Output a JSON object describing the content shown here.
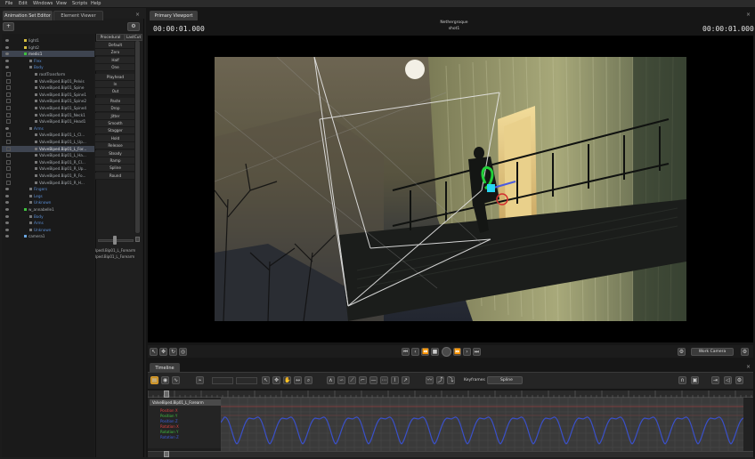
{
  "menu": [
    "File",
    "Edit",
    "Windows",
    "View",
    "Scripts",
    "Help"
  ],
  "left_tabs": {
    "animation_set_editor": "Animation Set Editor",
    "element_viewer": "Element Viewer"
  },
  "tree": [
    {
      "label": "light1",
      "type": "light",
      "state": "normal"
    },
    {
      "label": "light2",
      "type": "light",
      "state": "normal"
    },
    {
      "label": "medic1",
      "type": "model",
      "state": "selected"
    },
    {
      "label": "Flex",
      "type": "group",
      "state": "blue"
    },
    {
      "label": "Body",
      "type": "group",
      "state": "blue"
    },
    {
      "label": "rootTransform",
      "type": "item",
      "state": "normal"
    },
    {
      "label": "ValveBiped.Bip01_Pelvis",
      "type": "item",
      "state": "normal"
    },
    {
      "label": "ValveBiped.Bip01_Spine",
      "type": "item",
      "state": "normal"
    },
    {
      "label": "ValveBiped.Bip01_Spine1",
      "type": "item",
      "state": "normal"
    },
    {
      "label": "ValveBiped.Bip01_Spine2",
      "type": "item",
      "state": "normal"
    },
    {
      "label": "ValveBiped.Bip01_Spine4",
      "type": "item",
      "state": "normal"
    },
    {
      "label": "ValveBiped.Bip01_Neck1",
      "type": "item",
      "state": "normal"
    },
    {
      "label": "ValveBiped.Bip01_Head1",
      "type": "item",
      "state": "normal"
    },
    {
      "label": "Arms",
      "type": "group",
      "state": "blue"
    },
    {
      "label": "ValveBiped.Bip01_L_Cl...",
      "type": "item",
      "state": "normal"
    },
    {
      "label": "ValveBiped.Bip01_L_Up...",
      "type": "item",
      "state": "normal"
    },
    {
      "label": "ValveBiped.Bip01_L_For...",
      "type": "item",
      "state": "highlight"
    },
    {
      "label": "ValveBiped.Bip01_L_Ha...",
      "type": "item",
      "state": "normal"
    },
    {
      "label": "ValveBiped.Bip01_R_Cl...",
      "type": "item",
      "state": "normal"
    },
    {
      "label": "ValveBiped.Bip01_R_Up...",
      "type": "item",
      "state": "normal"
    },
    {
      "label": "ValveBiped.Bip01_R_Fo...",
      "type": "item",
      "state": "normal"
    },
    {
      "label": "ValveBiped.Bip01_R_H...",
      "type": "item",
      "state": "normal"
    },
    {
      "label": "Fingers",
      "type": "group",
      "state": "blue"
    },
    {
      "label": "Legs",
      "type": "group",
      "state": "blue"
    },
    {
      "label": "Unknown",
      "type": "group",
      "state": "blue"
    },
    {
      "label": "w_annabelle1",
      "type": "model",
      "state": "normal"
    },
    {
      "label": "Body",
      "type": "group",
      "state": "blue"
    },
    {
      "label": "Arms",
      "type": "group",
      "state": "blue"
    },
    {
      "label": "Unknown",
      "type": "group",
      "state": "blue"
    },
    {
      "label": "camera1",
      "type": "camera",
      "state": "normal"
    }
  ],
  "procedural": {
    "headers": [
      "Procedural",
      "LastCut"
    ],
    "items": [
      "Default",
      "Zero",
      "Half",
      "One",
      "Playhead",
      "In",
      "Out",
      "Paste",
      "Drop",
      "Jitter",
      "Smooth",
      "Stagger",
      "Hold",
      "Release",
      "Steady",
      "Ramp",
      "Spline",
      "Round"
    ]
  },
  "control_items": [
    "lpedl.Bip01_L_Forearm",
    "lped.Bip01_L_Forearm"
  ],
  "viewport": {
    "tab": "Primary Viewport",
    "timecode_left": "00:00:01.000",
    "timecode_right": "00:00:01.000",
    "camera_name": "Nethergroque",
    "shot_name": "shot1"
  },
  "viewbar": {
    "work_camera": "Work Camera"
  },
  "timeline": {
    "tab": "Timeline",
    "keyframes_label": "Keyframes",
    "interp_value": "Spline",
    "graph_title": "ValveBiped.Bip01_L_Forearm",
    "curves": [
      {
        "name": "Position X",
        "color": "#e04040"
      },
      {
        "name": "Position Y",
        "color": "#40c040"
      },
      {
        "name": "Position Z",
        "color": "#4060e0"
      },
      {
        "name": "Rotation X",
        "color": "#e04040"
      },
      {
        "name": "Rotation Y",
        "color": "#40c040"
      },
      {
        "name": "Rotation Z",
        "color": "#4060e0"
      }
    ]
  },
  "colors": {
    "accent_blue": "#5b8fd6",
    "selection": "#3e4450"
  }
}
